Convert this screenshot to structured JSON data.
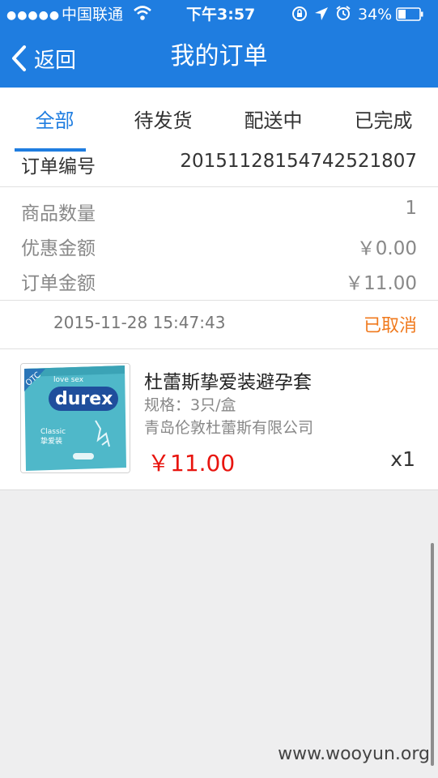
{
  "status_bar": {
    "signal": "●●●●●",
    "carrier": "中国联通",
    "time": "下午3:57",
    "battery": "34%"
  },
  "header": {
    "back_label": "返回",
    "title": "我的订单"
  },
  "tabs": [
    {
      "label": "全部",
      "active": true
    },
    {
      "label": "待发货",
      "active": false
    },
    {
      "label": "配送中",
      "active": false
    },
    {
      "label": "已完成",
      "active": false
    }
  ],
  "order": {
    "number_label": "订单编号",
    "number": "20151128154742521807",
    "quantity_label": "商品数量",
    "quantity": "1",
    "discount_label": "优惠金额",
    "discount": "￥0.00",
    "amount_label": "订单金额",
    "amount": "￥11.00",
    "datetime": "2015-11-28 15:47:43",
    "status": "已取消",
    "product": {
      "name": "杜蕾斯挚爱装避孕套",
      "spec": "规格：3只/盒",
      "maker": "青岛伦敦杜蕾斯有限公司",
      "price": "￥11.00",
      "qty": "x1",
      "thumb_text": {
        "brand": "durex",
        "badge": "OTC",
        "tag": "love sex",
        "line": "Classic",
        "cn": "挚爱装"
      }
    }
  },
  "watermark": "www.wooyun.org",
  "colors": {
    "accent": "#1f7de0",
    "status_orange": "#f07a1e",
    "price_red": "#e8150f"
  }
}
